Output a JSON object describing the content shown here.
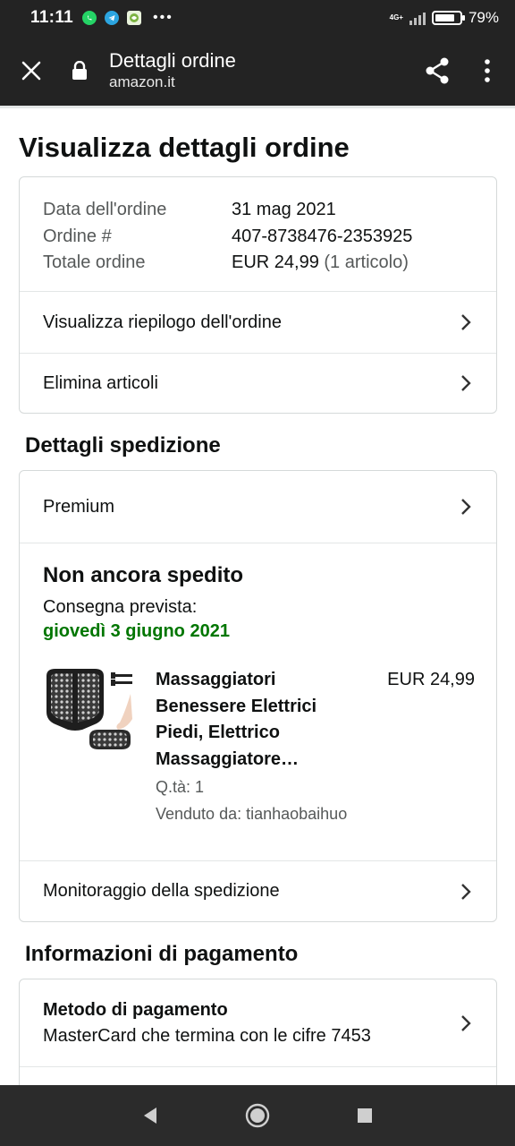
{
  "status_bar": {
    "time": "11:11",
    "more": "•••",
    "network": "4G+",
    "battery_percent_label": "79%",
    "battery_level": 0.79,
    "apps": [
      "whatsapp-icon",
      "telegram-icon",
      "app-icon"
    ]
  },
  "toolbar": {
    "title": "Dettagli ordine",
    "domain": "amazon.it"
  },
  "page": {
    "title": "Visualizza dettagli ordine"
  },
  "summary": {
    "rows": [
      {
        "label": "Data dell'ordine",
        "value": "31 mag 2021",
        "extra": ""
      },
      {
        "label": "Ordine #",
        "value": "407-8738476-2353925",
        "extra": ""
      },
      {
        "label": "Totale ordine",
        "value": "EUR 24,99",
        "extra": " (1 articolo)"
      }
    ],
    "links": [
      {
        "label": "Visualizza riepilogo dell'ordine"
      },
      {
        "label": "Elimina articoli"
      }
    ]
  },
  "shipping": {
    "section_title": "Dettagli spedizione",
    "method": "Premium",
    "status": "Non ancora spedito",
    "expected_label": "Consegna prevista:",
    "expected_date": "giovedì 3 giugno 2021",
    "item": {
      "title": "Massaggiatori Benessere Elettrici Piedi, Elettrico Massaggiatore…",
      "price": "EUR 24,99",
      "qty": "Q.tà: 1",
      "seller": "Venduto da: tianhaobaihuo"
    },
    "tracking": "Monitoraggio della spedizione"
  },
  "payment": {
    "section_title": "Informazioni di pagamento",
    "method_label": "Metodo di pagamento",
    "method_value": "MasterCard che termina con le cifre 7453"
  },
  "colors": {
    "bar_bg": "#232323",
    "delivery_green": "#007600",
    "border": "#d5d9d9",
    "muted_text": "#565959"
  }
}
